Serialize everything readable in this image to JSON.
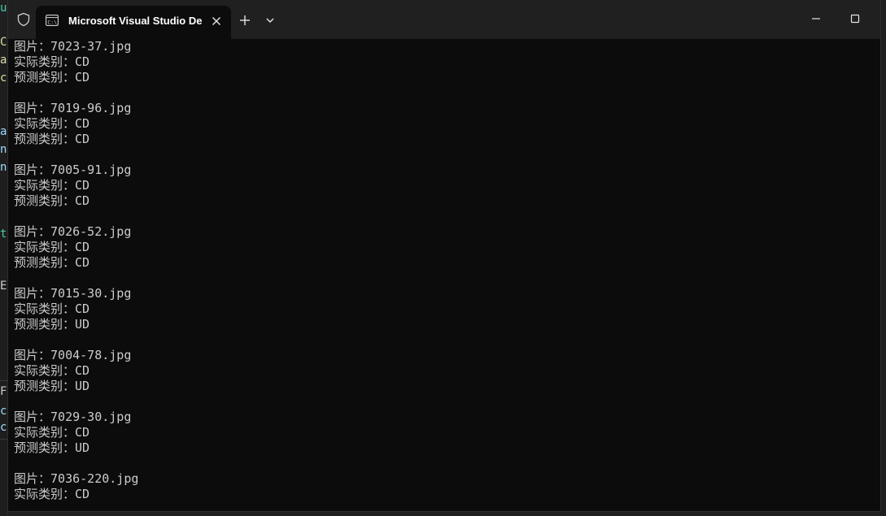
{
  "window": {
    "tab_title": "Microsoft Visual Studio Debug Console",
    "accent_color": "#0c0c0c",
    "titlebar_color": "#202020",
    "text_color": "#cccccc"
  },
  "background_ide": {
    "glyphs": [
      {
        "text": "u",
        "color": "#4ec9b0"
      },
      {
        "text": "C",
        "color": "#dcdcaa"
      },
      {
        "text": "a",
        "color": "#dcdcaa"
      },
      {
        "text": "c",
        "color": "#dcdcaa"
      },
      {
        "text": "a",
        "color": "#9cdcfe"
      },
      {
        "text": "n",
        "color": "#9cdcfe"
      },
      {
        "text": "n",
        "color": "#9cdcfe"
      },
      {
        "text": "t",
        "color": "#4ec9b0"
      },
      {
        "text": "E",
        "color": "#cccccc"
      },
      {
        "text": "F",
        "color": "#cccccc"
      },
      {
        "text": "c",
        "color": "#9cdcfe"
      },
      {
        "text": "c",
        "color": "#9cdcfe"
      }
    ]
  },
  "console": {
    "records": [
      {
        "image_label": "图片：",
        "image": "7023-37.jpg",
        "actual_label": "实际类别：",
        "actual": "CD",
        "predicted_label": "预测类别：",
        "predicted": "CD"
      },
      {
        "image_label": "图片：",
        "image": "7019-96.jpg",
        "actual_label": "实际类别：",
        "actual": "CD",
        "predicted_label": "预测类别：",
        "predicted": "CD"
      },
      {
        "image_label": "图片：",
        "image": "7005-91.jpg",
        "actual_label": "实际类别：",
        "actual": "CD",
        "predicted_label": "预测类别：",
        "predicted": "CD"
      },
      {
        "image_label": "图片：",
        "image": "7026-52.jpg",
        "actual_label": "实际类别：",
        "actual": "CD",
        "predicted_label": "预测类别：",
        "predicted": "CD"
      },
      {
        "image_label": "图片：",
        "image": "7015-30.jpg",
        "actual_label": "实际类别：",
        "actual": "CD",
        "predicted_label": "预测类别：",
        "predicted": "UD"
      },
      {
        "image_label": "图片：",
        "image": "7004-78.jpg",
        "actual_label": "实际类别：",
        "actual": "CD",
        "predicted_label": "预测类别：",
        "predicted": "UD"
      },
      {
        "image_label": "图片：",
        "image": "7029-30.jpg",
        "actual_label": "实际类别：",
        "actual": "CD",
        "predicted_label": "预测类别：",
        "predicted": "UD"
      },
      {
        "image_label": "图片：",
        "image": "7036-220.jpg",
        "actual_label": "实际类别：",
        "actual": "CD"
      }
    ]
  }
}
